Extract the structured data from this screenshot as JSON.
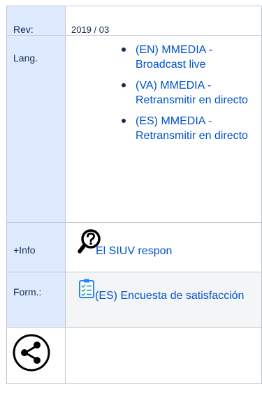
{
  "table": {
    "rev": {
      "label": "Rev:",
      "value": "2019 / 03"
    },
    "lang": {
      "label": "Lang.",
      "items": [
        {
          "text": "(EN) MMEDIA - Broadcast live"
        },
        {
          "text": "(VA) MMEDIA - Retransmitir en directo"
        },
        {
          "text": "(ES) MMEDIA - Retransmitir en directo"
        }
      ]
    },
    "info": {
      "label": "+Info",
      "link": "El SIUV respon",
      "icon": "question-magnifier-icon"
    },
    "form": {
      "label": "Form.:",
      "link": "(ES) Encuesta de satisfacción",
      "icon": "checklist-clipboard-icon"
    },
    "share": {
      "icon": "share-icon"
    }
  },
  "colors": {
    "label_bg": "#deebff",
    "link": "#0052cc",
    "border": "#c1c7d0",
    "shaded_bg": "#f4f5f7",
    "text": "#172b4d"
  }
}
